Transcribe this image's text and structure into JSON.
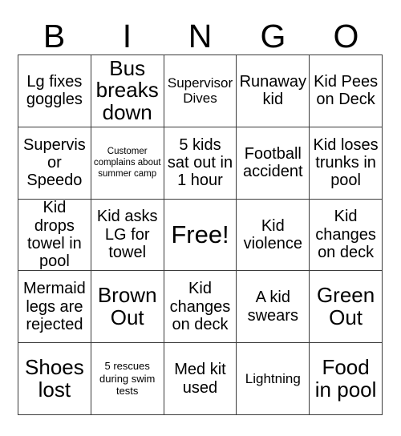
{
  "card": {
    "title": "BINGO",
    "header_letters": [
      "B",
      "I",
      "N",
      "G",
      "O"
    ],
    "border_color": "#3b3b3b",
    "background_color": "#ffffff",
    "text_color": "#000000",
    "columns": 5,
    "rows": 5,
    "free_space_label": "Free!",
    "free_space_position": "row3-col3"
  },
  "cells": [
    {
      "text": "Lg fixes goggles",
      "size": "md"
    },
    {
      "text": "Bus breaks down",
      "size": "lg"
    },
    {
      "text": "Supervisor Dives",
      "size": "sm"
    },
    {
      "text": "Runaway kid",
      "size": "md"
    },
    {
      "text": "Kid Pees on Deck",
      "size": "md"
    },
    {
      "text": "Supervisor Speedo",
      "size": "md"
    },
    {
      "text": "Customer complains about summer camp",
      "size": "xxs"
    },
    {
      "text": "5 kids sat out in 1 hour",
      "size": "md"
    },
    {
      "text": "Football accident",
      "size": "md"
    },
    {
      "text": "Kid loses trunks in pool",
      "size": "md"
    },
    {
      "text": "Kid drops towel in pool",
      "size": "md"
    },
    {
      "text": "Kid asks LG for towel",
      "size": "md"
    },
    {
      "text": "Free!",
      "size": "xl"
    },
    {
      "text": "Kid violence",
      "size": "md"
    },
    {
      "text": "Kid changes on deck",
      "size": "md"
    },
    {
      "text": "Mermaid legs are rejected",
      "size": "md"
    },
    {
      "text": "Brown Out",
      "size": "lg"
    },
    {
      "text": "Kid changes on deck",
      "size": "md"
    },
    {
      "text": "A kid swears",
      "size": "md"
    },
    {
      "text": "Green Out",
      "size": "lg"
    },
    {
      "text": "Shoes lost",
      "size": "lg"
    },
    {
      "text": "5 rescues during swim tests",
      "size": "xs"
    },
    {
      "text": "Med kit used",
      "size": "md"
    },
    {
      "text": "Lightning",
      "size": "sm"
    },
    {
      "text": "Food in pool",
      "size": "lg"
    }
  ]
}
